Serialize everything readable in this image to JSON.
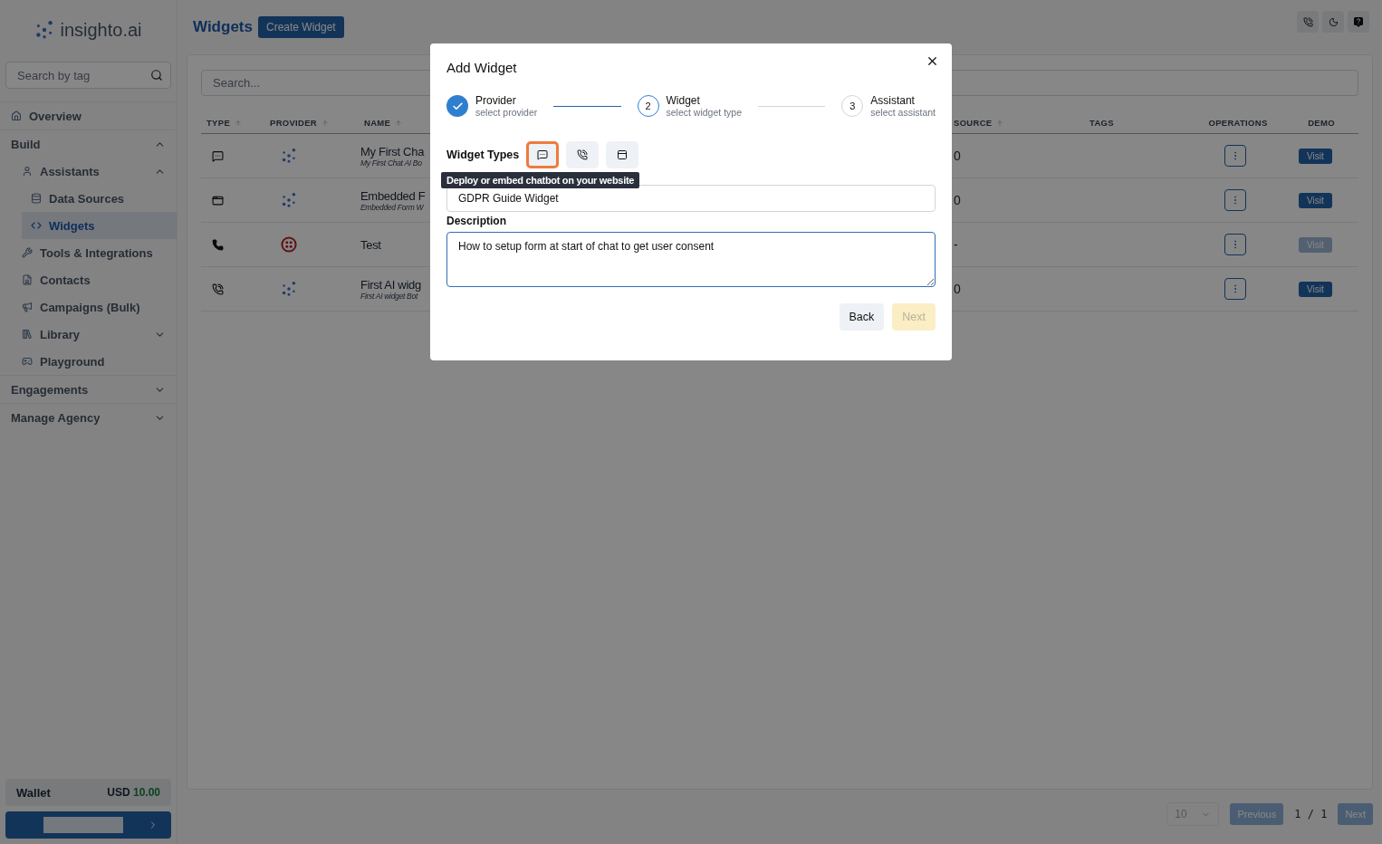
{
  "sidebar": {
    "brand": "insighto.ai",
    "search": {
      "placeholder": "Search by tag"
    },
    "items": [
      {
        "kind": "link",
        "label": "Overview",
        "selected": false
      },
      {
        "kind": "section",
        "label": "Build",
        "expanded": true,
        "children": [
          {
            "kind": "link",
            "label": "Assistants",
            "expanded": true,
            "selected": false,
            "children": [
              {
                "kind": "link",
                "label": "Data Sources",
                "selected": false
              },
              {
                "kind": "link",
                "label": "Widgets",
                "selected": true
              }
            ]
          },
          {
            "kind": "link",
            "label": "Tools & Integrations",
            "selected": false
          },
          {
            "kind": "link",
            "label": "Contacts",
            "selected": false
          },
          {
            "kind": "link",
            "label": "Campaigns (Bulk)",
            "selected": false
          },
          {
            "kind": "link",
            "label": "Library",
            "expanded": false,
            "selected": false
          },
          {
            "kind": "link",
            "label": "Playground",
            "selected": false
          }
        ]
      },
      {
        "kind": "section",
        "label": "Engagements",
        "expanded": false
      },
      {
        "kind": "section",
        "label": "Manage Agency",
        "expanded": false
      }
    ],
    "wallet": {
      "label": "Wallet",
      "currency": "USD",
      "amount": "10.00"
    }
  },
  "header": {
    "title": "Widgets",
    "create_button": "Create Widget"
  },
  "table": {
    "search": {
      "placeholder": "Search..."
    },
    "columns": [
      {
        "label": "TYPE",
        "sortable": true
      },
      {
        "label": "PROVIDER",
        "sortable": true
      },
      {
        "label": "NAME",
        "sortable": true
      },
      {
        "label": "SOURCE",
        "sortable": true
      },
      {
        "label": "TAGS",
        "sortable": false
      },
      {
        "label": "OPERATIONS",
        "sortable": false
      },
      {
        "label": "DEMO",
        "sortable": false
      }
    ],
    "rows": [
      {
        "type": {
          "kind": "chat"
        },
        "provider": {
          "kind": "insighto"
        },
        "name": "My First Cha",
        "subtitle": "My First Chat AI Bo",
        "source": "0",
        "visit": "Visit",
        "visit_disabled": false
      },
      {
        "type": {
          "kind": "window"
        },
        "provider": {
          "kind": "insighto"
        },
        "name": "Embedded F",
        "subtitle": "Embedded Form W",
        "source": "0",
        "visit": "Visit",
        "visit_disabled": false
      },
      {
        "type": {
          "kind": "phone"
        },
        "provider": {
          "kind": "twilio"
        },
        "name": "Test",
        "source": "-",
        "visit": "Visit",
        "visit_disabled": true
      },
      {
        "type": {
          "kind": "phone-call"
        },
        "provider": {
          "kind": "insighto"
        },
        "name": "First AI widg",
        "subtitle": "First AI widget Bot",
        "source": "0",
        "visit": "Visit",
        "visit_disabled": false
      }
    ]
  },
  "pagination": {
    "page_size": "10",
    "previous": "Previous",
    "previous_disabled": true,
    "page": "1",
    "separator": "/",
    "total": "1",
    "next": "Next",
    "next_disabled": true
  },
  "dialog": {
    "title": "Add Widget",
    "steps": [
      {
        "title": "Provider",
        "subtitle": "select provider",
        "completed": true,
        "current": false
      },
      {
        "number": "2",
        "title": "Widget",
        "subtitle": "select widget type",
        "completed": false,
        "current": true
      },
      {
        "number": "3",
        "title": "Assistant",
        "subtitle": "select assistant",
        "completed": false,
        "current": false
      }
    ],
    "widget_types_label": "Widget Types",
    "widget_types": [
      {
        "kind": "chat",
        "selected": true
      },
      {
        "kind": "phone-call",
        "selected": false
      },
      {
        "kind": "form",
        "selected": false
      }
    ],
    "tooltip": "Deploy or embed chatbot on your website",
    "name_value": "GDPR Guide Widget",
    "description_label": "Description",
    "description_value": "How to setup form at start of chat to get user consent",
    "back": "Back",
    "next": "Next",
    "next_disabled": true
  }
}
